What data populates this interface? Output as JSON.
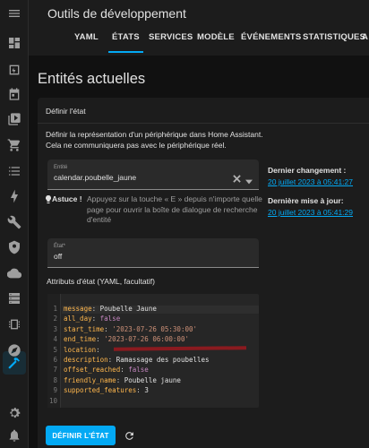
{
  "header": {
    "title": "Outils de développement",
    "tabs": [
      {
        "label": "YAML",
        "active": false
      },
      {
        "label": "ÉTATS",
        "active": true
      },
      {
        "label": "SERVICES",
        "active": false
      },
      {
        "label": "MODÈLE",
        "active": false
      },
      {
        "label": "ÉVÉNEMENTS",
        "active": false
      },
      {
        "label": "STATISTIQUES",
        "active": false
      },
      {
        "label": "A",
        "active": false
      }
    ]
  },
  "sidebar": {
    "items": [
      {
        "icon": "menu-icon"
      },
      {
        "icon": "dashboard-icon"
      },
      {
        "icon": "energy-icon"
      },
      {
        "icon": "calendar-icon"
      },
      {
        "icon": "media-icon"
      },
      {
        "icon": "shopping-cart-icon"
      },
      {
        "icon": "list-icon"
      },
      {
        "icon": "lightning-icon"
      },
      {
        "icon": "wrench-icon"
      },
      {
        "icon": "shield-icon"
      },
      {
        "icon": "cloud-icon"
      },
      {
        "icon": "server-icon"
      },
      {
        "icon": "chip-icon"
      },
      {
        "icon": "compass-icon"
      },
      {
        "icon": "hammer-icon",
        "active": true
      },
      {
        "icon": "settings-icon"
      },
      {
        "icon": "notifications-icon"
      }
    ]
  },
  "main": {
    "page_title": "Entités actuelles",
    "card_title": "Définir l'état",
    "description": "Définir la représentation d'un périphérique dans Home Assistant. Cela ne communiquera pas avec le périphérique réel.",
    "entity_field": {
      "label": "Entité",
      "value": "calendar.poubelle_jaune"
    },
    "tip": {
      "label": "Astuce !",
      "text": "Appuyez sur la touche « E » depuis n'importe quelle page pour ouvrir la boîte de dialogue de recherche d'entité"
    },
    "state_field": {
      "label": "État*",
      "value": "off"
    },
    "attributes_label": "Attributs d'état (YAML, facultatif)",
    "code_lines": [
      {
        "no": "1",
        "key": "message",
        "value": "Poubelle Jaune",
        "type": "plain"
      },
      {
        "no": "2",
        "key": "all_day",
        "value": "false",
        "type": "bool"
      },
      {
        "no": "3",
        "key": "start_time",
        "value": "'2023-07-26 05:30:00'",
        "type": "string"
      },
      {
        "no": "4",
        "key": "end_time",
        "value": "'2023-07-26 06:00:00'",
        "type": "string"
      },
      {
        "no": "5",
        "key": "location",
        "value": "",
        "type": "plain"
      },
      {
        "no": "6",
        "key": "description",
        "value": "Ramassage des poubelles",
        "type": "plain"
      },
      {
        "no": "7",
        "key": "offset_reached",
        "value": "false",
        "type": "bool"
      },
      {
        "no": "8",
        "key": "friendly_name",
        "value": "Poubelle jaune",
        "type": "plain"
      },
      {
        "no": "9",
        "key": "supported_features",
        "value": "3",
        "type": "number"
      },
      {
        "no": "10",
        "key": "",
        "value": "",
        "type": "plain"
      }
    ],
    "submit_label": "DÉFINIR L'ÉTAT",
    "last_changed_title": "Dernier changement :",
    "last_changed_value": "20 juillet 2023 à 05:41:27",
    "last_updated_title": "Dernière mise à jour:",
    "last_updated_value": "20 juillet 2023 à 05:41:29"
  },
  "colors": {
    "accent": "#03a9f4",
    "background": "#111111",
    "card": "#1c1c1c",
    "redaction": "#8a1a1f"
  }
}
